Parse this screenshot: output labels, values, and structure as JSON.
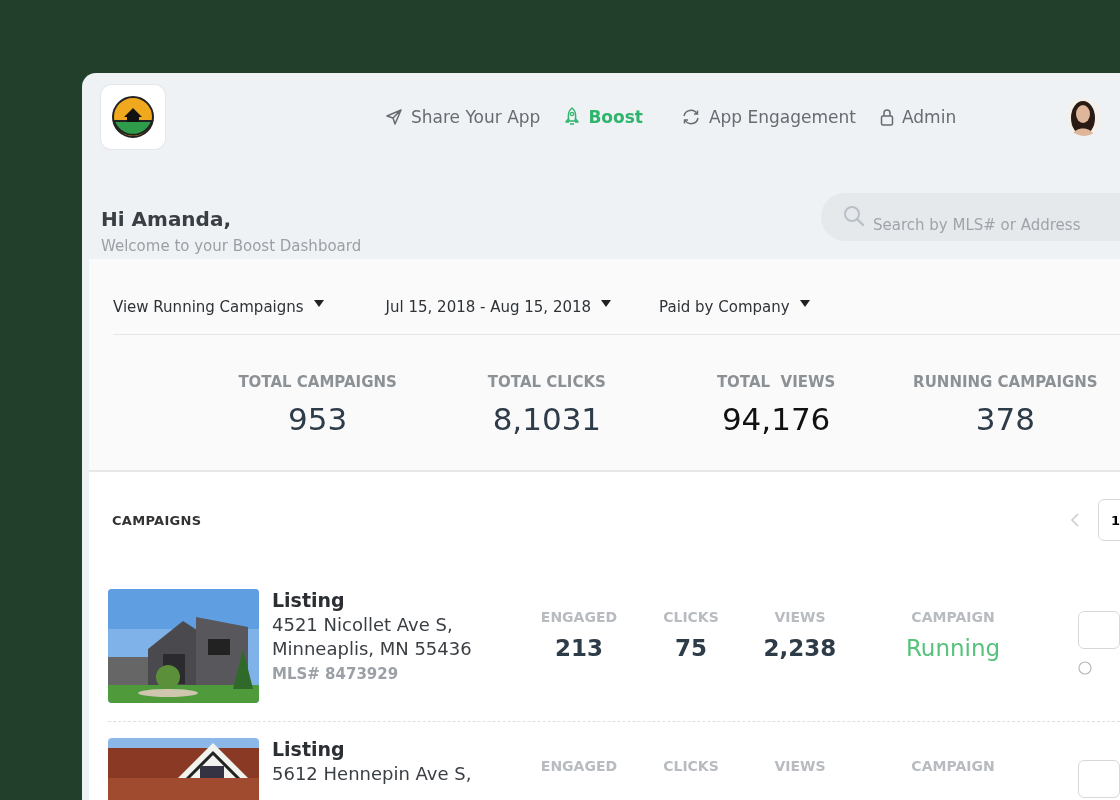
{
  "nav": [
    {
      "label": "Share Your App",
      "selected": false
    },
    {
      "label": "Boost",
      "selected": true
    },
    {
      "label": "App Engagement",
      "selected": false
    },
    {
      "label": "Admin",
      "selected": false
    }
  ],
  "greeting": {
    "title": "Hi Amanda,",
    "subtitle": "Welcome to your Boost Dashboard"
  },
  "search": {
    "placeholder": "Search by MLS# or Address"
  },
  "filters": [
    {
      "label": "View Running Campaigns"
    },
    {
      "label": "Jul 15, 2018 - Aug 15, 2018"
    },
    {
      "label": "Paid by Company"
    }
  ],
  "stats": [
    {
      "label": "TOTAL CAMPAIGNS",
      "value": "953"
    },
    {
      "label": "TOTAL CLICKS",
      "value": "8,1031"
    },
    {
      "label": "TOTAL  VIEWS",
      "value": "94,176"
    },
    {
      "label": "RUNNING CAMPAIGNS",
      "value": "378"
    }
  ],
  "campaigns": {
    "title": "CAMPAIGNS",
    "page": "1",
    "rows": [
      {
        "type": "Listing",
        "address": [
          "4521 Nicollet Ave S,",
          "Minneaplis, MN 55436"
        ],
        "mls": "MLS# 8473929",
        "metrics": [
          {
            "label": "ENGAGED",
            "value": "213"
          },
          {
            "label": "CLICKS",
            "value": "75"
          },
          {
            "label": "VIEWS",
            "value": "2,238"
          },
          {
            "label": "CAMPAIGN",
            "value": "Running",
            "kind": "status"
          }
        ]
      },
      {
        "type": "Listing",
        "address": [
          "5612 Hennepin Ave S,"
        ],
        "metrics": [
          {
            "label": "ENGAGED"
          },
          {
            "label": "CLICKS"
          },
          {
            "label": "VIEWS"
          },
          {
            "label": "CAMPAIGN",
            "kind": "status"
          }
        ]
      }
    ]
  }
}
